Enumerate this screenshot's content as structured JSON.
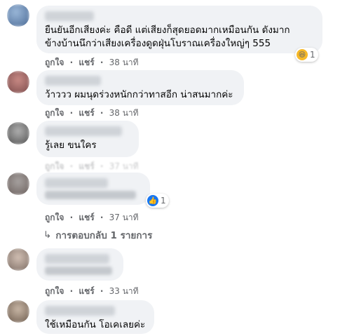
{
  "comments": [
    {
      "text_lines": [
        "ยืนยันอีกเสียงค่ะ คือดี แต่เสียงก็สุดยอดมากเหมือนกัน ดังมาก",
        "ข้างบ้านนึกว่าเสียงเครื่องดูดฝุ่นโบราณเครื่องใหญ่ๆ 555"
      ],
      "reaction": {
        "icon": "haha-icon",
        "count": "1"
      },
      "actions": {
        "like": "ถูกใจ",
        "sep": "·",
        "share": "แชร์",
        "time": "38 นาที"
      }
    },
    {
      "text_lines": [
        "ว้าววว ผมนุดร่วงหนักกว่าทาสอีก น่าสนมากค่ะ"
      ],
      "actions": {
        "like": "ถูกใจ",
        "sep": "·",
        "share": "แชร์",
        "time": "38 นาที"
      }
    },
    {
      "text_lines": [
        "รู้เลย ขนใคร"
      ],
      "actions": {
        "like": "ถูกใจ",
        "sep": "·",
        "share": "แชร์",
        "time": "37 นาที"
      }
    },
    {
      "text_lines": [],
      "reaction": {
        "icon": "like-icon",
        "count": "1"
      },
      "actions": {
        "like": "ถูกใจ",
        "sep": "·",
        "share": "แชร์",
        "time": "37 นาที"
      }
    },
    {
      "text_lines": [],
      "actions": {
        "like": "ถูกใจ",
        "sep": "·",
        "share": "แชร์",
        "time": "33 นาที"
      }
    },
    {
      "text_lines": [
        "ใช้เหมือนกัน โอเคเลยค่ะ"
      ]
    }
  ],
  "replies_link": "การตอบกลับ 1 รายการ",
  "colors": {
    "bubble": "#f0f2f5",
    "meta": "#65676b",
    "like_blue": "#1877f2",
    "haha_yellow": "#f7b928"
  }
}
